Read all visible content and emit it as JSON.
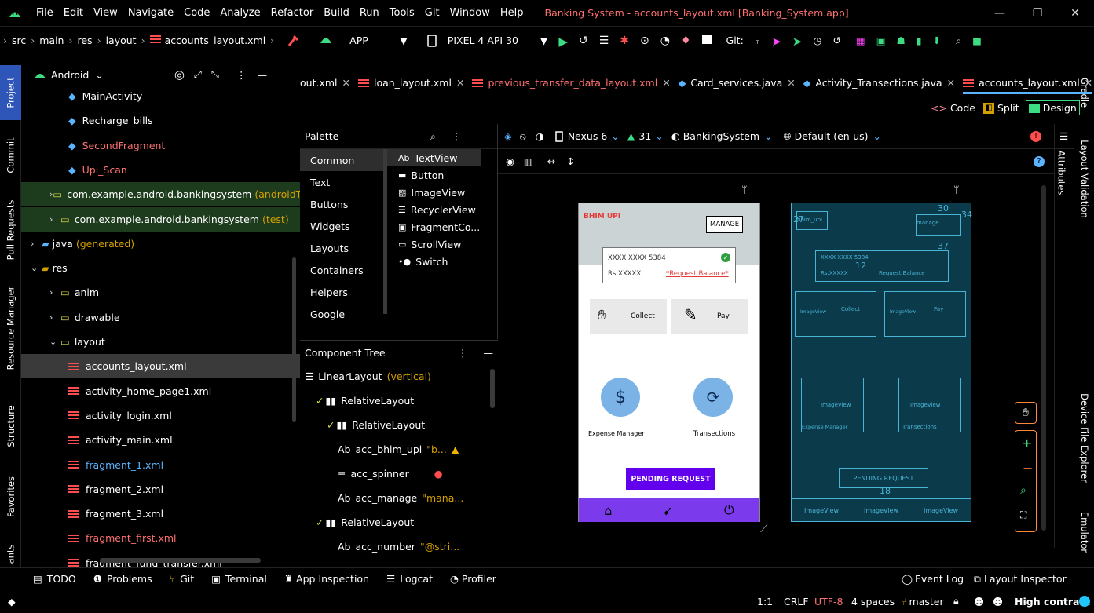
{
  "menu": [
    "File",
    "Edit",
    "View",
    "Navigate",
    "Code",
    "Analyze",
    "Refactor",
    "Build",
    "Run",
    "Tools",
    "Git",
    "Window",
    "Help"
  ],
  "window_title": "Banking System - accounts_layout.xml [Banking_System.app]",
  "breadcrumb": [
    "src",
    "main",
    "res",
    "layout",
    "accounts_layout.xml"
  ],
  "run_config": "APP",
  "device": "PIXEL 4 API 30",
  "git_label": "Git:",
  "left_tabs": [
    "Project",
    "Commit",
    "Pull Requests",
    "Resource Manager",
    "Structure",
    "Favorites",
    "ants"
  ],
  "right_tabs": [
    "Gradle",
    "Layout Validation",
    "Device File Explorer",
    "Emulator"
  ],
  "project_view": "Android",
  "tree": [
    {
      "label": "MainActivity",
      "kind": "class",
      "indent": 5,
      "color": "#ffffff"
    },
    {
      "label": "Recharge_bills",
      "kind": "class",
      "indent": 5,
      "color": "#ffffff"
    },
    {
      "label": "SecondFragment",
      "kind": "class",
      "indent": 5,
      "color": "#ff7070"
    },
    {
      "label": "Upi_Scan",
      "kind": "class",
      "indent": 5,
      "color": "#ff7070"
    },
    {
      "label": "com.example.android.bankingsystem",
      "suffix": "(androidTest)",
      "kind": "pkg",
      "indent": 3,
      "color": "#ffffff",
      "bg": "#1d3b1d"
    },
    {
      "label": "com.example.android.bankingsystem",
      "suffix": "(test)",
      "kind": "pkg",
      "indent": 3,
      "color": "#ffffff",
      "bg": "#1d3b1d"
    },
    {
      "label": "java",
      "suffix": "(generated)",
      "kind": "javagen",
      "indent": 1,
      "color": "#ffffff"
    },
    {
      "label": "res",
      "kind": "res",
      "indent": 1,
      "color": "#ffffff",
      "open": true
    },
    {
      "label": "anim",
      "kind": "folder",
      "indent": 3,
      "color": "#ffffff"
    },
    {
      "label": "drawable",
      "kind": "folder",
      "indent": 3,
      "color": "#ffffff"
    },
    {
      "label": "layout",
      "kind": "folder",
      "indent": 3,
      "color": "#ffffff",
      "open": true
    },
    {
      "label": "accounts_layout.xml",
      "kind": "xml",
      "indent": 5,
      "color": "#ffffff",
      "selected": true
    },
    {
      "label": "activity_home_page1.xml",
      "kind": "xml",
      "indent": 5,
      "color": "#ffffff"
    },
    {
      "label": "activity_login.xml",
      "kind": "xml",
      "indent": 5,
      "color": "#ffffff"
    },
    {
      "label": "activity_main.xml",
      "kind": "xml",
      "indent": 5,
      "color": "#ffffff"
    },
    {
      "label": "fragment_1.xml",
      "kind": "xml",
      "indent": 5,
      "color": "#5ab4ff"
    },
    {
      "label": "fragment_2.xml",
      "kind": "xml",
      "indent": 5,
      "color": "#ffffff"
    },
    {
      "label": "fragment_3.xml",
      "kind": "xml",
      "indent": 5,
      "color": "#ffffff"
    },
    {
      "label": "fragment_first.xml",
      "kind": "xml",
      "indent": 5,
      "color": "#ff7070"
    },
    {
      "label": "fragment_fund_transfer.xml",
      "kind": "xml",
      "indent": 5,
      "color": "#ffffff"
    }
  ],
  "editor_tabs": [
    {
      "label": "out.xml",
      "color": "#ffffff",
      "icon": "none"
    },
    {
      "label": "loan_layout.xml",
      "color": "#ffffff",
      "icon": "xml"
    },
    {
      "label": "previous_transfer_data_layout.xml",
      "color": "#ff7070",
      "icon": "xml"
    },
    {
      "label": "Card_services.java",
      "color": "#ffffff",
      "icon": "class"
    },
    {
      "label": "Activity_Transections.java",
      "color": "#ffffff",
      "icon": "class"
    },
    {
      "label": "accounts_layout.xml",
      "color": "#ffffff",
      "icon": "xml",
      "active": true
    }
  ],
  "view_modes": {
    "code": "Code",
    "split": "Split",
    "design": "Design"
  },
  "palette": {
    "title": "Palette",
    "categories": [
      "Common",
      "Text",
      "Buttons",
      "Widgets",
      "Layouts",
      "Containers",
      "Helpers",
      "Google"
    ],
    "items": [
      "TextView",
      "Button",
      "ImageView",
      "RecyclerView",
      "FragmentCo...",
      "ScrollView",
      "Switch"
    ]
  },
  "design_toolbar": {
    "device": "Nexus 6",
    "api": "31",
    "theme": "BankingSystem",
    "locale": "Default (en-us)"
  },
  "attributes_tab": "Attributes",
  "component_tree": {
    "title": "Component Tree",
    "rows": [
      {
        "label": "LinearLayout",
        "extra": "(vertical)",
        "indent": 0,
        "icon": "layout"
      },
      {
        "label": "RelativeLayout",
        "indent": 1,
        "icon": "rel",
        "chev": true
      },
      {
        "label": "RelativeLayout",
        "indent": 2,
        "icon": "rel",
        "chev": true
      },
      {
        "label": "acc_bhim_upi",
        "extra": "\"b...",
        "indent": 3,
        "icon": "ab",
        "status": "warn"
      },
      {
        "label": "acc_spinner",
        "indent": 3,
        "icon": "spinner",
        "status": "error"
      },
      {
        "label": "acc_manage",
        "extra": "\"mana...",
        "indent": 3,
        "icon": "ab"
      },
      {
        "label": "RelativeLayout",
        "indent": 1,
        "icon": "rel",
        "chev": true
      },
      {
        "label": "acc_number",
        "extra": "\"@stri...",
        "indent": 3,
        "icon": "ab"
      }
    ]
  },
  "phone": {
    "bhim": "BHIM UPI",
    "manage": "MANAGE",
    "acct": "XXXX XXXX 5384",
    "bal": "Rs.XXXXX",
    "req_bal": "*Request Balance*",
    "collect": "Collect",
    "pay": "Pay",
    "expense": "Expense Manager",
    "trans": "Transections",
    "pending": "PENDING REQUEST",
    "accent": "#6200ee"
  },
  "blueprint": {
    "bhim": "bhim_upi",
    "manage": "manage",
    "acct": "XXXX XXXX 5384",
    "bal": "Rs.XXXXX",
    "req": "Request Balance",
    "collect": "Collect",
    "pay": "Pay",
    "imgview": "ImageView",
    "expense": "Expense Manager",
    "trans": "Transections",
    "pending": "PENDING REQUEST",
    "n27": "27",
    "n30": "30",
    "n34": "34",
    "n37": "37",
    "n12": "12",
    "n18": "18"
  },
  "bottom_tools": [
    "TODO",
    "Problems",
    "Git",
    "Terminal",
    "App Inspection",
    "Logcat",
    "Profiler"
  ],
  "bottom_right_tools": [
    "Event Log",
    "Layout Inspector"
  ],
  "status": {
    "pos": "1:1",
    "eol": "CRLF",
    "enc": "UTF-8",
    "indent": "4 spaces",
    "branch": "master",
    "contrast": "High contrast"
  }
}
